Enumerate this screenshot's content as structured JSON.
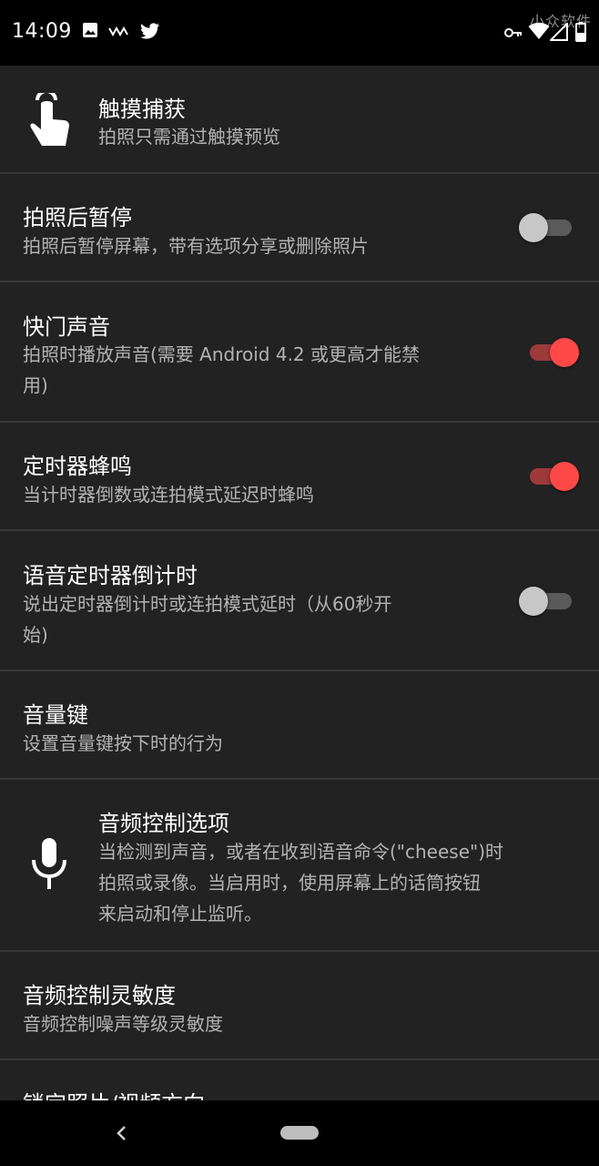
{
  "status_bar": {
    "time": "14:09",
    "watermark": "小众软件",
    "left_icons": [
      "image-icon",
      "signal-waves-icon",
      "twitter-icon"
    ],
    "right_icons": [
      "key-icon",
      "wifi-icon",
      "cell-signal-icon",
      "battery-icon"
    ]
  },
  "settings": {
    "touch_capture": {
      "title": "触摸捕获",
      "summary": "拍照只需通过触摸预览",
      "icon": "touch-hand-icon"
    },
    "pause_after": {
      "title": "拍照后暂停",
      "summary": "拍照后暂停屏幕，带有选项分享或删除照片",
      "enabled": false
    },
    "shutter_sound": {
      "title": "快门声音",
      "summary_line1": "拍照时播放声音(需要 Android 4.2 或更高才能禁",
      "summary_line2": "用)",
      "enabled": true
    },
    "timer_beep": {
      "title": "定时器蜂鸣",
      "summary": "当计时器倒数或连拍模式延迟时蜂鸣",
      "enabled": true
    },
    "voice_timer": {
      "title": "语音定时器倒计时",
      "summary_line1": "说出定时器倒计时或连拍模式延时（从60秒开",
      "summary_line2": "始)",
      "enabled": false
    },
    "volume_keys": {
      "title": "音量键",
      "summary": "设置音量键按下时的行为"
    },
    "audio_control": {
      "title": "音频控制选项",
      "summary_line1": "当检测到声音，或者在收到语音命令(\"cheese\")时",
      "summary_line2": "拍照或录像。当启用时，使用屏幕上的话筒按钮",
      "summary_line3": "来启动和停止监听。",
      "icon": "microphone-icon"
    },
    "audio_sensitivity": {
      "title": "音频控制灵敏度",
      "summary": "音频控制噪声等级灵敏度"
    },
    "lock_orientation": {
      "title": "锁定照片/视频方向"
    }
  },
  "nav_bar": {
    "back_icon": "back-chevron-icon",
    "home_icon": "home-pill-icon"
  },
  "colors": {
    "switch_on": "#ff4848",
    "switch_off": "#c7c7c7",
    "background": "#222222"
  }
}
